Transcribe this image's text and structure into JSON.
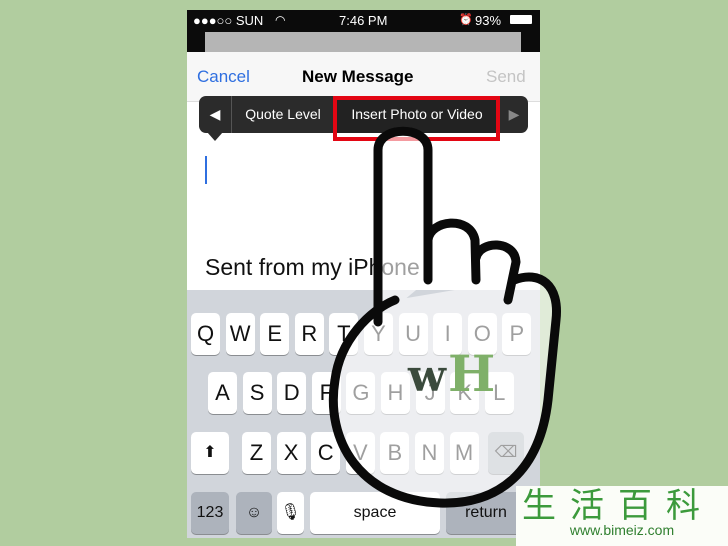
{
  "status": {
    "carrier": "●●●○○ SUN",
    "time": "7:46 PM",
    "battery": "93%"
  },
  "nav": {
    "cancel": "Cancel",
    "title": "New Message",
    "send": "Send"
  },
  "toolbar": {
    "prev": "◀",
    "quote": "Quote Level",
    "insert": "Insert Photo or Video",
    "next": "▶"
  },
  "body": {
    "signature": "Sent from my iPhone"
  },
  "keyboard": {
    "row1": [
      "Q",
      "W",
      "E",
      "R",
      "T",
      "Y",
      "U",
      "I",
      "O",
      "P"
    ],
    "row2": [
      "A",
      "S",
      "D",
      "F",
      "G",
      "H",
      "J",
      "K",
      "L"
    ],
    "row3": [
      "Z",
      "X",
      "C",
      "V",
      "B",
      "N",
      "M"
    ],
    "shift": "⬆",
    "delete": "⌫",
    "numbers": "123",
    "emoji": "☺",
    "mic": "🎙",
    "space": "space",
    "return": "return"
  },
  "logo": {
    "w": "w",
    "h": "H"
  },
  "watermark": {
    "chars": "生活百科",
    "url": "www.bimeiz.com"
  },
  "colors": {
    "accent": "#2f6fe0",
    "highlight": "#e30613",
    "logo_dark": "#3a4a3c",
    "logo_green": "#7fb069"
  }
}
